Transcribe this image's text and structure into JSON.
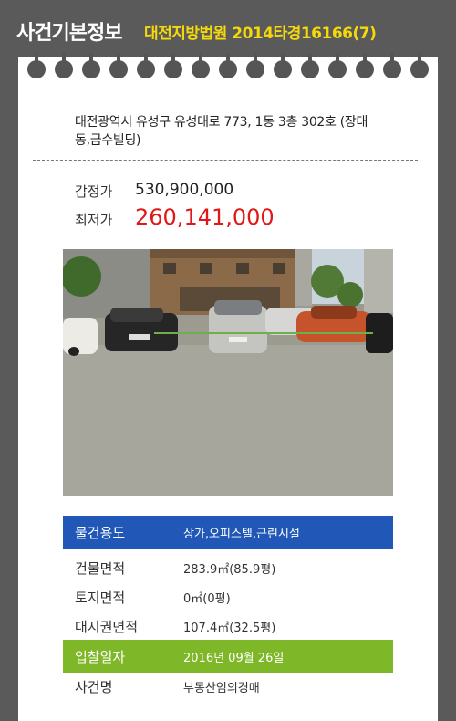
{
  "header": {
    "title": "사건기본정보",
    "case_info": "대전지방법원 2014타경16166(7)"
  },
  "address": "대전광역시 유성구 유성대로 773, 1동 3층 302호 (장대동,금수빌딩)",
  "prices": {
    "appraisal_label": "감정가",
    "appraisal_value": "530,900,000",
    "minimum_label": "최저가",
    "minimum_value": "260,141,000"
  },
  "details": {
    "usage": {
      "label": "물건용도",
      "value": "상가,오피스텔,근린시설"
    },
    "building_area": {
      "label": "건물면적",
      "value": "283.9㎡(85.9평)"
    },
    "land_area": {
      "label": "토지면적",
      "value": "0㎡(0평)"
    },
    "land_right_area": {
      "label": "대지권면적",
      "value": "107.4㎡(32.5평)"
    },
    "bid_date": {
      "label": "입찰일자",
      "value": "2016년 09월 26일"
    },
    "case_name": {
      "label": "사건명",
      "value": "부동산임의경매"
    }
  },
  "colors": {
    "accent_blue": "#2158b8",
    "accent_green": "#7eb728",
    "price_red": "#e01818",
    "header_yellow": "#f5d90a"
  }
}
